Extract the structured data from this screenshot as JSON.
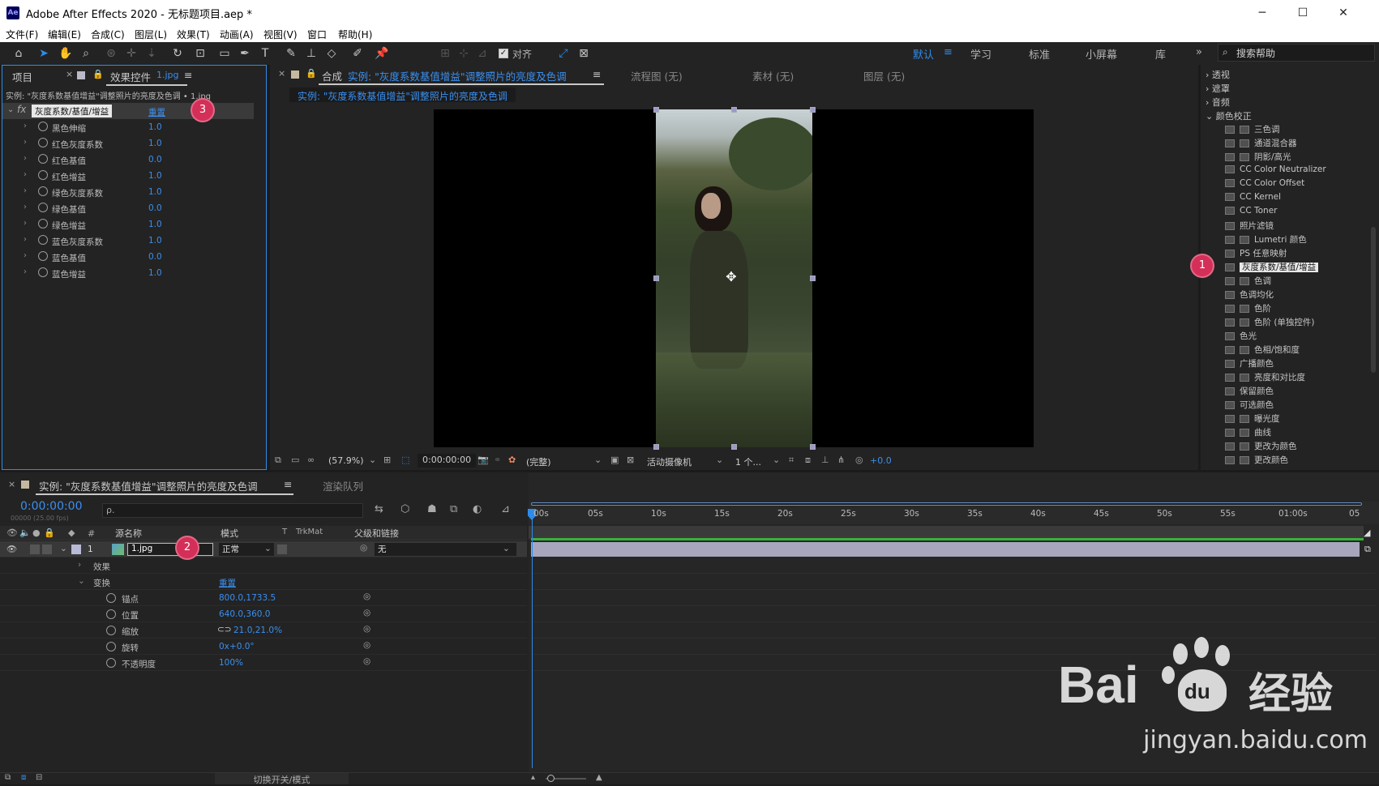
{
  "titlebar": {
    "app_icon": "Ae",
    "title": "Adobe After Effects 2020 - 无标题项目.aep *",
    "min": "─",
    "max": "☐",
    "close": "✕"
  },
  "menu": [
    "文件(F)",
    "编辑(E)",
    "合成(C)",
    "图层(L)",
    "效果(T)",
    "动画(A)",
    "视图(V)",
    "窗口",
    "帮助(H)"
  ],
  "toolbar": {
    "snap_label": "对齐",
    "workspaces": [
      "默认",
      "学习",
      "标准",
      "小屏幕",
      "库"
    ],
    "more": "»",
    "search_placeholder": "搜索帮助"
  },
  "project_tab": "项目",
  "effects_tab": {
    "label": "效果控件",
    "file": "1.jpg",
    "menu": "≡"
  },
  "effects": {
    "breadcrumb": "实例: \"灰度系数基值增益\"调整照片的亮度及色调 • 1.jpg",
    "fx": "fx",
    "effect_name": "灰度系数/基值/增益",
    "reset": "重置",
    "params": [
      {
        "name": "黑色伸缩",
        "value": "1.0"
      },
      {
        "name": "红色灰度系数",
        "value": "1.0"
      },
      {
        "name": "红色基值",
        "value": "0.0"
      },
      {
        "name": "红色增益",
        "value": "1.0"
      },
      {
        "name": "绿色灰度系数",
        "value": "1.0"
      },
      {
        "name": "绿色基值",
        "value": "0.0"
      },
      {
        "name": "绿色增益",
        "value": "1.0"
      },
      {
        "name": "蓝色灰度系数",
        "value": "1.0"
      },
      {
        "name": "蓝色基值",
        "value": "0.0"
      },
      {
        "name": "蓝色增益",
        "value": "1.0"
      }
    ]
  },
  "comp": {
    "tab_prefix": "合成",
    "tab_name": "实例: \"灰度系数基值增益\"调整照片的亮度及色调",
    "menu": "≡",
    "other_tabs": [
      "流程图 (无)",
      "素材 (无)",
      "图层 (无)"
    ],
    "sub_tab": "实例: \"灰度系数基值增益\"调整照片的亮度及色调",
    "footer": {
      "zoom": "(57.9%)",
      "timecode": "0:00:00:00",
      "quality": "(完整)",
      "camera": "活动摄像机",
      "views": "1 个...",
      "exposure": "+0.0"
    }
  },
  "effects_browser": {
    "categories": [
      "透视",
      "遮罩",
      "音频",
      "颜色校正"
    ],
    "items": [
      "三色调",
      "通道混合器",
      "阴影/高光",
      "CC Color Neutralizer",
      "CC Color Offset",
      "CC Kernel",
      "CC Toner",
      "照片滤镜",
      "Lumetri 颜色",
      "PS 任意映射",
      "灰度系数/基值/增益",
      "色调",
      "色调均化",
      "色阶",
      "色阶 (单独控件)",
      "色光",
      "色相/饱和度",
      "广播颜色",
      "亮度和对比度",
      "保留颜色",
      "可选颜色",
      "曝光度",
      "曲线",
      "更改为颜色",
      "更改颜色"
    ]
  },
  "badges": [
    "1",
    "2",
    "3"
  ],
  "timeline": {
    "tab_name": "实例: \"灰度系数基值增益\"调整照片的亮度及色调",
    "render_queue": "渲染队列",
    "menu": "≡",
    "timecode": "0:00:00:00",
    "timecode_sub": "00000 (25.00 fps)",
    "search_placeholder": "ρ.",
    "headers": {
      "num": "#",
      "source": "源名称",
      "mode": "模式",
      "t": "T",
      "trkmat": "TrkMat",
      "parent": "父级和链接"
    },
    "layer": {
      "index": "1",
      "name": "1.jpg",
      "mode": "正常",
      "parent": "无"
    },
    "groups": {
      "effects": "效果",
      "transform": "变换",
      "reset": "重置"
    },
    "props": [
      {
        "name": "锚点",
        "value": "800.0,1733.5"
      },
      {
        "name": "位置",
        "value": "640.0,360.0"
      },
      {
        "name": "缩放",
        "value": "21.0,21.0%"
      },
      {
        "name": "旋转",
        "value": "0x+0.0°"
      },
      {
        "name": "不透明度",
        "value": "100%"
      }
    ],
    "ruler": [
      "00s",
      "05s",
      "10s",
      "15s",
      "20s",
      "25s",
      "30s",
      "35s",
      "40s",
      "45s",
      "50s",
      "55s",
      "01:00s",
      "05"
    ],
    "footer": "切换开关/模式"
  },
  "watermark": {
    "brand": "Bai",
    "paw": "du",
    "cn": "经验",
    "url": "jingyan.baidu.com"
  }
}
